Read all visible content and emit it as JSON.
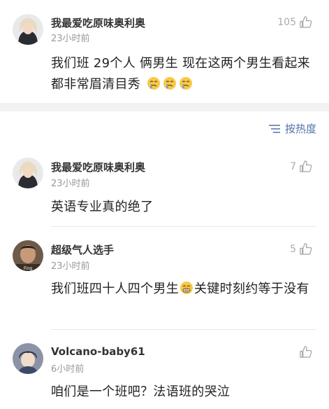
{
  "top_comment": {
    "name": "我最爱吃原味奥利奥",
    "time": "23小时前",
    "likes": "105",
    "text": "我们班 29个人 俩男生 现在这两个男生看起来都非常眉清目秀",
    "emojis": [
      "crying-face-icon",
      "crying-face-icon",
      "crying-face-icon"
    ]
  },
  "sort": {
    "label": "按热度",
    "icon": "sort-lines-icon"
  },
  "comments": [
    {
      "name": "我最爱吃原味奥利奥",
      "time": "23小时前",
      "likes": "7",
      "text": "英语专业真的绝了"
    },
    {
      "name": "超级气人选手",
      "time": "23小时前",
      "likes": "5",
      "text_part1": "我们班四十人四个男生",
      "text_part2": "关键时刻约等于没有",
      "emoji": "grinning-face-icon",
      "avatar_caption": "Fing"
    },
    {
      "name": "Volcano-baby61",
      "time": "6小时前",
      "likes": "",
      "text": "咱们是一个班吧？法语班的哭泣"
    }
  ],
  "colors": {
    "link": "#5273a8",
    "time": "#999999",
    "like_icon": "#aaaaaa"
  }
}
